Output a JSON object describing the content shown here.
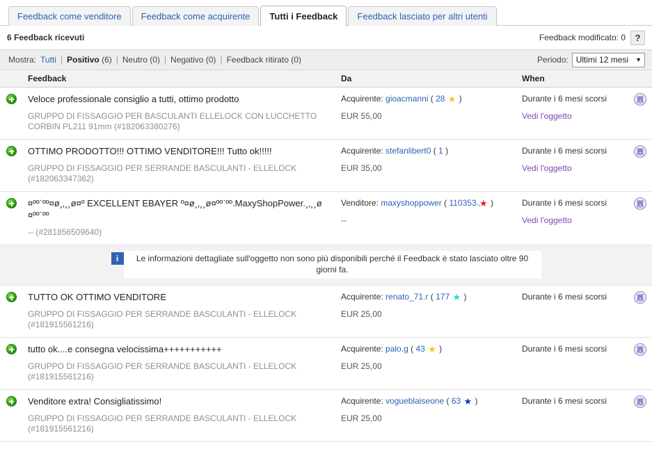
{
  "tabs": [
    {
      "label": "Feedback come venditore",
      "active": false
    },
    {
      "label": "Feedback come acquirente",
      "active": false
    },
    {
      "label": "Tutti i Feedback",
      "active": true
    },
    {
      "label": "Feedback lasciato per altri utenti",
      "active": false
    }
  ],
  "summary": {
    "received": "6 Feedback ricevuti",
    "revised": "Feedback modificato: 0",
    "help_label": "?"
  },
  "filter": {
    "show_label": "Mostra:",
    "options": [
      {
        "label": "Tutti",
        "count": "",
        "style": "link"
      },
      {
        "label": "Positivo",
        "count": "(6)",
        "style": "strong"
      },
      {
        "label": "Neutro",
        "count": "(0)",
        "style": "plain"
      },
      {
        "label": "Negativo",
        "count": "(0)",
        "style": "plain"
      },
      {
        "label": "Feedback ritirato",
        "count": "(0)",
        "style": "plain"
      }
    ],
    "period_label": "Periodo:",
    "period_value": "Ultimi 12 mesi",
    "period_caret": "▼"
  },
  "columns": {
    "feedback": "Feedback",
    "from": "Da",
    "when": "When"
  },
  "icons": {
    "rating_positive": "green-plus-icon",
    "reply": "member-reply-icon",
    "star_glyph": "★"
  },
  "rows": [
    {
      "rating": "positive",
      "comment": "Veloce professionale consiglio a tutti, ottimo prodotto",
      "item": "GRUPPO DI FISSAGGIO PER BASCULANTI ELLELOCK CON LUCCHETTO CORBIN PL211 91mm (#182063380276)",
      "role": "Acquirente:",
      "user": "gioacmanni",
      "score": "28",
      "star_color": "#f5c518",
      "star_type": "normal",
      "price": "EUR 55,00",
      "when": "Durante i 6 mesi scorsi",
      "link": "Vedi l'oggetto"
    },
    {
      "rating": "positive",
      "comment": "OTTIMO PRODOTTO!!! OTTIMO VENDITORE!!! Tutto ok!!!!!",
      "item": "GRUPPO DI FISSAGGIO PER SERRANDE BASCULANTI - ELLELOCK (#182063347362)",
      "role": "Acquirente:",
      "user": "stefanlibert0",
      "score": "1",
      "star_color": "",
      "star_type": "none",
      "price": "EUR 35,00",
      "when": "Durante i 6 mesi scorsi",
      "link": "Vedi l'oggetto"
    },
    {
      "rating": "positive",
      "comment": "¤ººˋºº¤ø¸‚¸¸ø¤º EXCELLENT EBAYER º¤ø¸‚¸¸ø¤ººˋºº.MaxyShopPower.¸‚¸¸ø ¤ººˋºº",
      "item": "-- (#281856509640)",
      "role": "Venditore:",
      "user": "maxyshoppower",
      "score": "110353",
      "star_color": "#e8182a",
      "star_type": "shooting",
      "price": "--",
      "when": "Durante i 6 mesi scorsi",
      "link": "Vedi l'oggetto"
    },
    {
      "rating": "positive",
      "comment": "TUTTO OK OTTIMO VENDITORE",
      "item": "GRUPPO DI FISSAGGIO PER SERRANDE BASCULANTI - ELLELOCK (#181915561216)",
      "role": "Acquirente:",
      "user": "renato_71.r",
      "score": "177",
      "star_color": "#2fd2d2",
      "star_type": "normal",
      "price": "EUR 25,00",
      "when": "Durante i 6 mesi scorsi",
      "link": ""
    },
    {
      "rating": "positive",
      "comment": "tutto ok....e consegna velocissima+++++++++++",
      "item": "GRUPPO DI FISSAGGIO PER SERRANDE BASCULANTI - ELLELOCK (#181915561216)",
      "role": "Acquirente:",
      "user": "palo.g",
      "score": "43",
      "star_color": "#f5c518",
      "star_type": "normal",
      "price": "EUR 25,00",
      "when": "Durante i 6 mesi scorsi",
      "link": ""
    },
    {
      "rating": "positive",
      "comment": "Venditore extra! Consigliatissimo!",
      "item": "GRUPPO DI FISSAGGIO PER SERRANDE BASCULANTI - ELLELOCK (#181915561216)",
      "role": "Acquirente:",
      "user": "vogueblaiseone",
      "score": "63",
      "star_color": "#1030d8",
      "star_type": "normal",
      "price": "EUR 25,00",
      "when": "Durante i 6 mesi scorsi",
      "link": ""
    }
  ],
  "info_notice": {
    "icon": "i",
    "text": "Le informazioni dettagliate sull'oggetto non sono più disponibili perché il Feedback è stato lasciato oltre 90 giorni fa."
  },
  "info_after_row_index": 2
}
